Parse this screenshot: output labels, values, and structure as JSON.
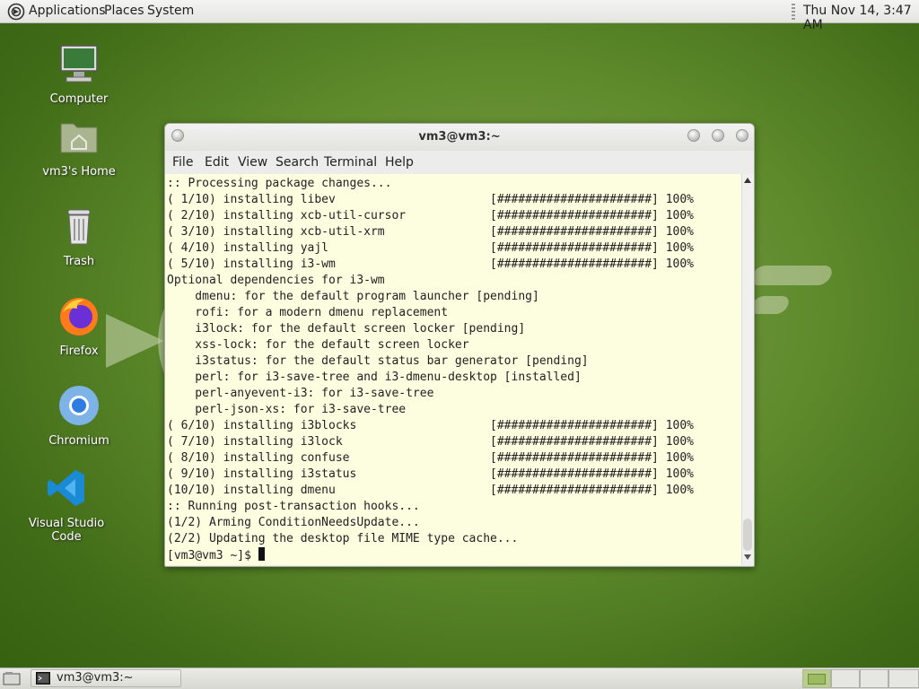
{
  "top_panel": {
    "applications": "Applications",
    "places": "Places",
    "system": "System",
    "clock": "Thu Nov 14,  3:47 AM"
  },
  "desktop_icons": {
    "computer": "Computer",
    "home": "vm3's Home",
    "trash": "Trash",
    "firefox": "Firefox",
    "chromium": "Chromium",
    "vscode": "Visual Studio Code"
  },
  "terminal": {
    "title": "vm3@vm3:~",
    "menu": {
      "file": "File",
      "edit": "Edit",
      "view": "View",
      "search": "Search",
      "terminal": "Terminal",
      "help": "Help"
    },
    "lines": [
      ":: Processing package changes...",
      "( 1/10) installing libev                      [######################] 100%",
      "( 2/10) installing xcb-util-cursor            [######################] 100%",
      "( 3/10) installing xcb-util-xrm               [######################] 100%",
      "( 4/10) installing yajl                       [######################] 100%",
      "( 5/10) installing i3-wm                      [######################] 100%",
      "Optional dependencies for i3-wm",
      "    dmenu: for the default program launcher [pending]",
      "    rofi: for a modern dmenu replacement",
      "    i3lock: for the default screen locker [pending]",
      "    xss-lock: for the default screen locker",
      "    i3status: for the default status bar generator [pending]",
      "    perl: for i3-save-tree and i3-dmenu-desktop [installed]",
      "    perl-anyevent-i3: for i3-save-tree",
      "    perl-json-xs: for i3-save-tree",
      "( 6/10) installing i3blocks                   [######################] 100%",
      "( 7/10) installing i3lock                     [######################] 100%",
      "( 8/10) installing confuse                    [######################] 100%",
      "( 9/10) installing i3status                   [######################] 100%",
      "(10/10) installing dmenu                      [######################] 100%",
      ":: Running post-transaction hooks...",
      "(1/2) Arming ConditionNeedsUpdate...",
      "(2/2) Updating the desktop file MIME type cache..."
    ],
    "prompt": "[vm3@vm3 ~]$ "
  },
  "bottom_panel": {
    "task_label": "vm3@vm3:~"
  },
  "icons": {
    "apps": "apps-menu-icon",
    "computer": "computer-icon",
    "home": "home-folder-icon",
    "trash": "trash-icon",
    "firefox": "firefox-icon",
    "chromium": "chromium-icon",
    "vscode": "vscode-icon"
  },
  "colors": {
    "terminal_bg": "#fdfde0",
    "desktop_green": "#5e8a2c"
  }
}
